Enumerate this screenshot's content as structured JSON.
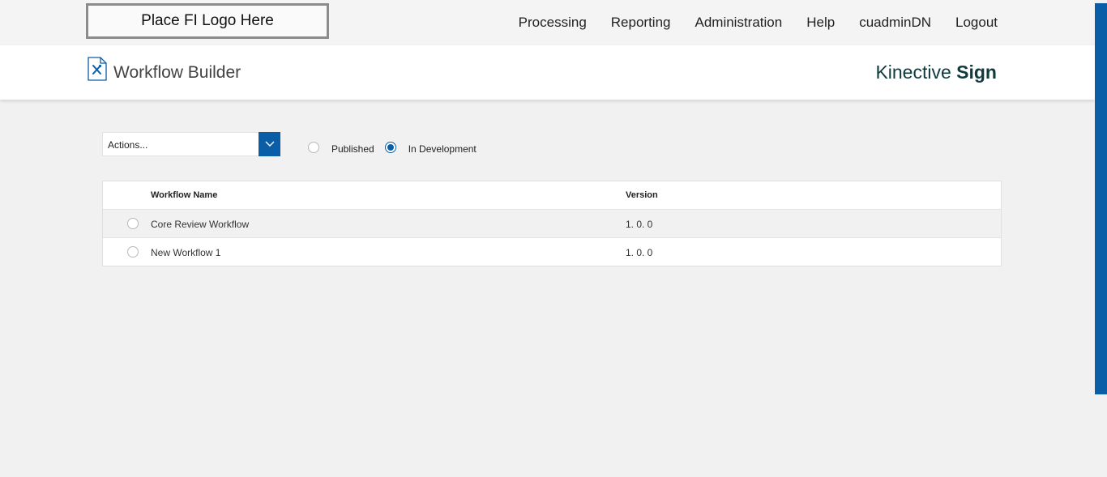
{
  "header": {
    "logo_placeholder": "Place FI Logo Here",
    "nav": [
      "Processing",
      "Reporting",
      "Administration",
      "Help",
      "cuadminDN",
      "Logout"
    ]
  },
  "titlebar": {
    "page_title": "Workflow Builder",
    "brand_light": "Kinective",
    "brand_bold": "Sign",
    "icon": "document-tools-icon"
  },
  "toolbar": {
    "actions_value": "Actions...",
    "filter_options": [
      {
        "label": "Published",
        "selected": false
      },
      {
        "label": "In Development",
        "selected": true
      }
    ]
  },
  "table": {
    "columns": [
      "Workflow Name",
      "Version"
    ],
    "rows": [
      {
        "name": "Core Review Workflow",
        "version": "1. 0. 0"
      },
      {
        "name": "New Workflow 1",
        "version": "1. 0. 0"
      }
    ]
  },
  "colors": {
    "accent": "#0a5ea8",
    "brand_text": "#0f3b3f"
  }
}
